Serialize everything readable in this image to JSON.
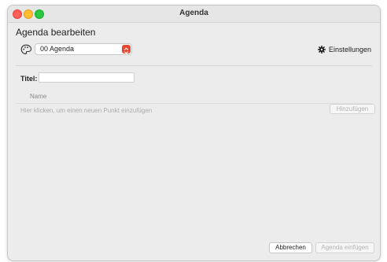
{
  "window": {
    "title": "Agenda"
  },
  "dialog": {
    "heading": "Agenda bearbeiten"
  },
  "selector": {
    "value": "00 Agenda",
    "icon": "palette-icon"
  },
  "settings": {
    "label": "Einstellungen",
    "icon": "gear-icon"
  },
  "form": {
    "title_label": "Titel:",
    "title_value": ""
  },
  "list": {
    "column_header": "Name",
    "hint": "Hier klicken, um einen neuen Punkt einzufügen",
    "add_label": "Hinzufügen"
  },
  "footer": {
    "cancel_label": "Abbrechen",
    "insert_label": "Agenda einfügen"
  },
  "colors": {
    "accent": "#e5482f",
    "window_bg": "#ececec"
  }
}
